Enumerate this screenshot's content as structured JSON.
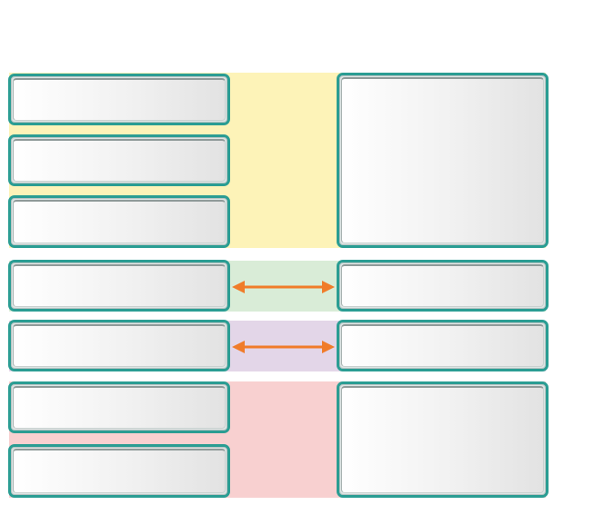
{
  "diagram": {
    "colors": {
      "box_border": "#2a9d93",
      "arrow": "#f07c2a",
      "band_yellow": "#fdf3b8",
      "band_green": "#d9ecd7",
      "band_purple": "#e3d6e8",
      "band_pink": "#f8d0d0"
    },
    "left_boxes": [
      "",
      "",
      "",
      "",
      "",
      "",
      ""
    ],
    "right_boxes": [
      "",
      "",
      "",
      ""
    ],
    "connectors": [
      {
        "from": "left-box-4",
        "to": "right-box-2",
        "direction": "both"
      },
      {
        "from": "left-box-5",
        "to": "right-box-3",
        "direction": "both"
      }
    ]
  }
}
